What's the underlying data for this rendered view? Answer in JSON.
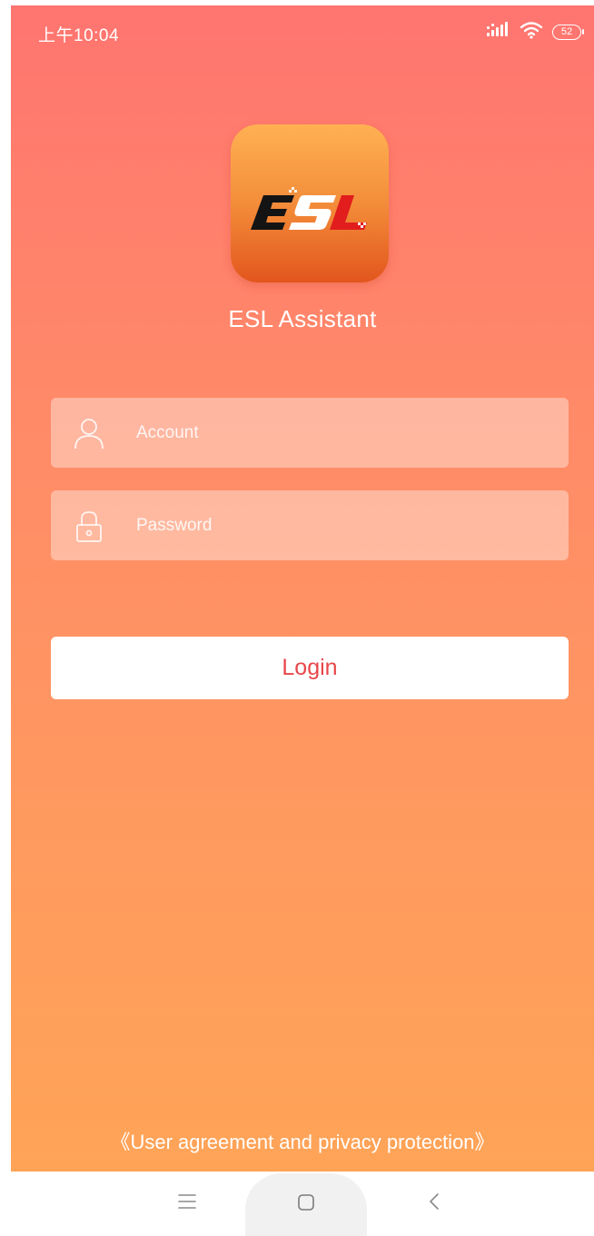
{
  "status_bar": {
    "time": "上午10:04",
    "battery": "52",
    "icons": [
      "signal-icon",
      "wifi-icon",
      "battery-icon"
    ]
  },
  "app": {
    "logo_text": "ESL",
    "name": "ESL Assistant"
  },
  "form": {
    "account": {
      "placeholder": "Account",
      "value": "",
      "icon": "user-icon"
    },
    "password": {
      "placeholder": "Password",
      "value": "",
      "icon": "lock-icon"
    },
    "login_label": "Login"
  },
  "footer": {
    "agreement_link": "《User agreement and privacy protection》"
  },
  "nav_bar": {
    "icons": [
      "menu-icon",
      "home-icon",
      "back-icon"
    ]
  },
  "colors": {
    "gradient_top": "#ff7570",
    "gradient_bottom": "#ffa457",
    "button_text": "#e8474a",
    "logo_red": "#e11d1d"
  }
}
